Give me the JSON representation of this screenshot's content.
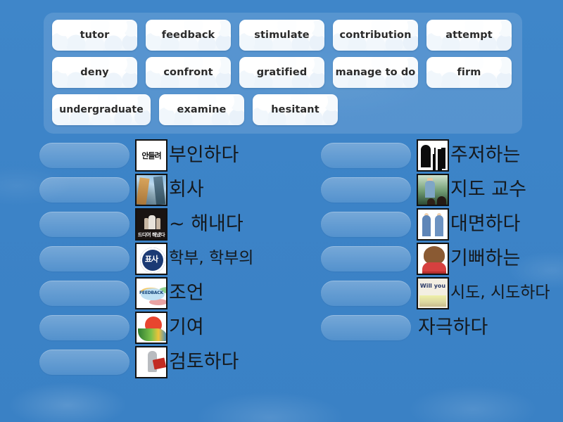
{
  "theme": {
    "background_color": "#3d85c8",
    "panel_color": "rgba(255,255,255,0.13)",
    "tile_color": "#ffffff",
    "dropzone_color": "rgba(255,255,255,0.25)",
    "text_color": "#15191d"
  },
  "word_bank": {
    "rows": [
      [
        {
          "label": "tutor",
          "icon": "cloud-tile"
        },
        {
          "label": "feedback",
          "icon": "cloud-tile"
        },
        {
          "label": "stimulate",
          "icon": "cloud-tile"
        },
        {
          "label": "contribution",
          "icon": "cloud-tile"
        },
        {
          "label": "attempt",
          "icon": "cloud-tile"
        }
      ],
      [
        {
          "label": "deny",
          "icon": "cloud-tile"
        },
        {
          "label": "confront",
          "icon": "cloud-tile"
        },
        {
          "label": "gratified",
          "icon": "cloud-tile"
        },
        {
          "label": "manage to do",
          "icon": "cloud-tile"
        },
        {
          "label": "firm",
          "icon": "cloud-tile"
        }
      ],
      [
        {
          "label": "undergraduate",
          "icon": "cloud-tile"
        },
        {
          "label": "examine",
          "icon": "cloud-tile"
        },
        {
          "label": "hesitant",
          "icon": "cloud-tile"
        }
      ]
    ]
  },
  "left_column": {
    "rows": [
      {
        "text": "부인하다",
        "has_image": true,
        "image_name": "deny-cartoon-thumbnail"
      },
      {
        "text": "회사",
        "has_image": true,
        "image_name": "skyscrapers-photo-thumbnail"
      },
      {
        "text": "~ 해내다",
        "has_image": true,
        "image_name": "celebration-photo-thumbnail"
      },
      {
        "text": "학부, 학부의",
        "has_image": true,
        "image_name": "university-emblem-thumbnail"
      },
      {
        "text": "조언",
        "has_image": true,
        "image_name": "feedback-diagram-thumbnail"
      },
      {
        "text": "기여",
        "has_image": true,
        "image_name": "contribution-heart-thumbnail"
      },
      {
        "text": "검토하다",
        "has_image": true,
        "image_name": "examine-person-thumbnail"
      }
    ]
  },
  "right_column": {
    "rows": [
      {
        "text": "주저하는",
        "has_image": true,
        "image_name": "hesitant-signpost-thumbnail"
      },
      {
        "text": "지도 교수",
        "has_image": true,
        "image_name": "tutor-classroom-photo-thumbnail"
      },
      {
        "text": "대면하다",
        "has_image": true,
        "image_name": "confront-two-people-thumbnail"
      },
      {
        "text": "기뻐하는",
        "has_image": true,
        "image_name": "gratified-happy-girl-thumbnail"
      },
      {
        "text": "시도, 시도하다",
        "has_image": true,
        "image_name": "attempt-will-you-try-thumbnail"
      },
      {
        "text": "자극하다",
        "has_image": false,
        "image_name": ""
      }
    ]
  }
}
